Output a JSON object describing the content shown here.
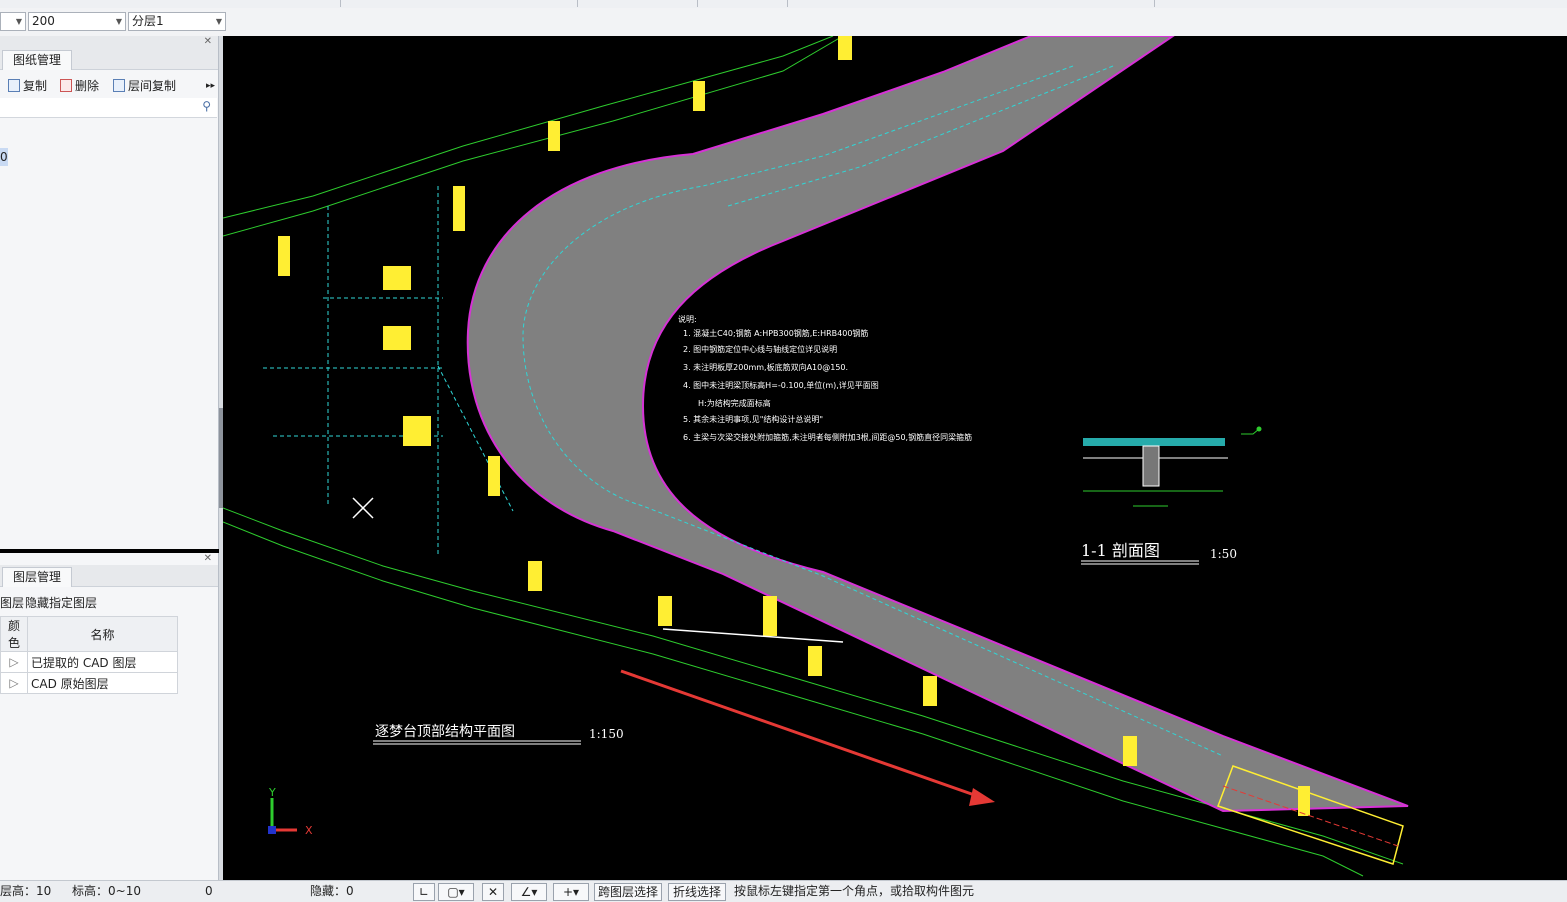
{
  "toolbar": {
    "combo1_value": "",
    "combo2_value": "200",
    "combo3_value": "分层1"
  },
  "drawing_panel": {
    "tab": "图纸管理",
    "copy_label": "复制",
    "delete_label": "删除",
    "floor_copy_label": "层间复制",
    "more": "▸▸",
    "tree_selected": "0"
  },
  "layer_panel": {
    "tab": "图层管理",
    "actions_label": "图层",
    "hide_label": "隐藏指定图层",
    "col_color": "颜色",
    "col_name": "名称",
    "rows": [
      {
        "name": "已提取的 CAD 图层"
      },
      {
        "name": "CAD 原始图层"
      }
    ]
  },
  "canvas": {
    "plan_title": "逐梦台顶部结构平面图",
    "plan_scale": "1:150",
    "section_title": "1-1 剖面图",
    "section_scale": "1:50",
    "notes": [
      "说明:",
      "1. 混凝土C40;钢筋 A:HPB300钢筋,E:HRB400钢筋",
      "2. 图中钢筋定位中心线与轴线定位详见说明",
      "3. 未注明板厚200mm,板底筋双向A10@150.",
      "4. 图中未注明梁顶标高H=-0.100,单位(m),详见平面图",
      "H:为结构完成面标高",
      "5. 其余未注明事项,见\"结构设计总说明\"",
      "6. 主梁与次梁交接处附加箍筋,未注明者每侧附加3根,间距@50,钢筋直径同梁箍筋"
    ],
    "axis_x": "X",
    "axis_y": "Y",
    "accent_color": "#e53935",
    "outline_color": "#d632d6",
    "slab_color": "#808080"
  },
  "statusbar": {
    "floor_height": "层高：10",
    "elevation": "标高：0~10",
    "zero": "0",
    "hidden": "隐藏：0",
    "cross_layer": "跨图层选择",
    "polyline_select": "折线选择",
    "hint": "按鼠标左键指定第一个角点，或拾取构件图元"
  }
}
